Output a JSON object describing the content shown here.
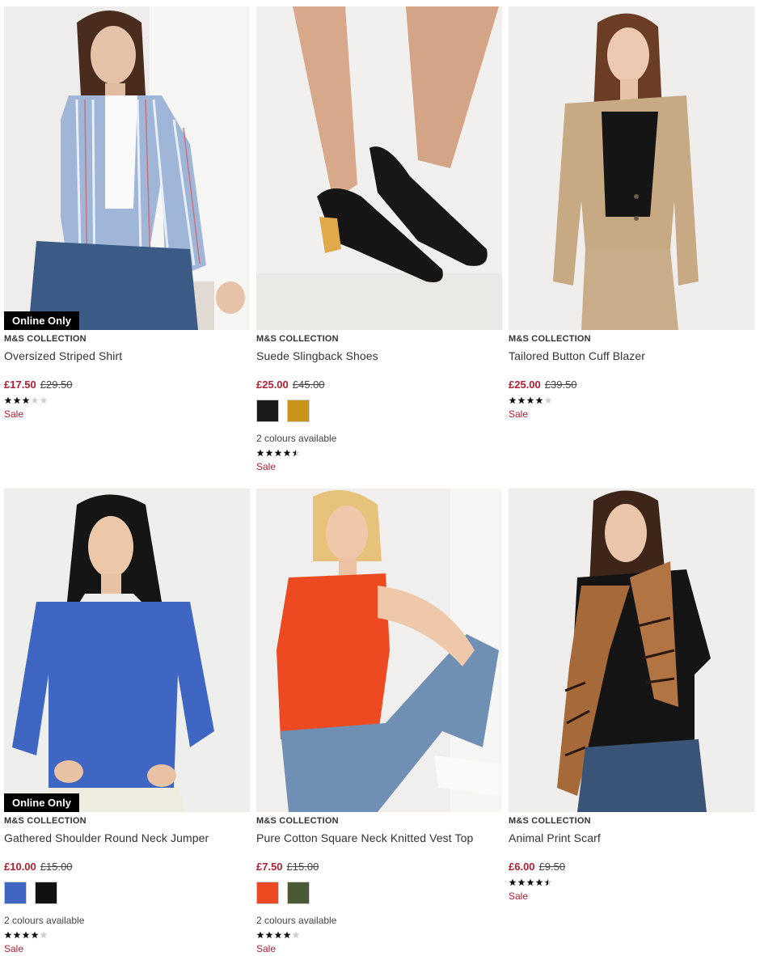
{
  "products": [
    {
      "brand": "M&S COLLECTION",
      "title": "Oversized Striped Shirt",
      "price_now": "£17.50",
      "price_was": "£29.50",
      "badge": "Online Only",
      "rating": 3,
      "swatches": [],
      "colours_text": "",
      "sale": "Sale"
    },
    {
      "brand": "M&S COLLECTION",
      "title": "Suede Slingback Shoes",
      "price_now": "£25.00",
      "price_was": "£45.00",
      "badge": "",
      "rating": 4.5,
      "swatches": [
        "#1a1a1a",
        "#c9941a"
      ],
      "colours_text": "2 colours available",
      "sale": "Sale"
    },
    {
      "brand": "M&S COLLECTION",
      "title": "Tailored Button Cuff Blazer",
      "price_now": "£25.00",
      "price_was": "£39.50",
      "badge": "",
      "rating": 4,
      "swatches": [],
      "colours_text": "",
      "sale": "Sale"
    },
    {
      "brand": "M&S COLLECTION",
      "title": "Gathered Shoulder Round Neck Jumper",
      "price_now": "£10.00",
      "price_was": "£15.00",
      "badge": "Online Only",
      "rating": 4,
      "swatches": [
        "#3f66c2",
        "#111111"
      ],
      "colours_text": "2 colours available",
      "sale": "Sale"
    },
    {
      "brand": "M&S COLLECTION",
      "title": "Pure Cotton Square Neck Knitted Vest Top",
      "price_now": "£7.50",
      "price_was": "£15.00",
      "badge": "",
      "rating": 4,
      "swatches": [
        "#ee4a22",
        "#4b5a34"
      ],
      "colours_text": "2 colours available",
      "sale": "Sale"
    },
    {
      "brand": "M&S COLLECTION",
      "title": "Animal Print Scarf",
      "price_now": "£6.00",
      "price_was": "£9.50",
      "badge": "",
      "rating": 4.5,
      "swatches": [],
      "colours_text": "",
      "sale": "Sale"
    }
  ],
  "colors": {
    "sale_red": "#b01e32",
    "badge_bg": "#000000"
  }
}
